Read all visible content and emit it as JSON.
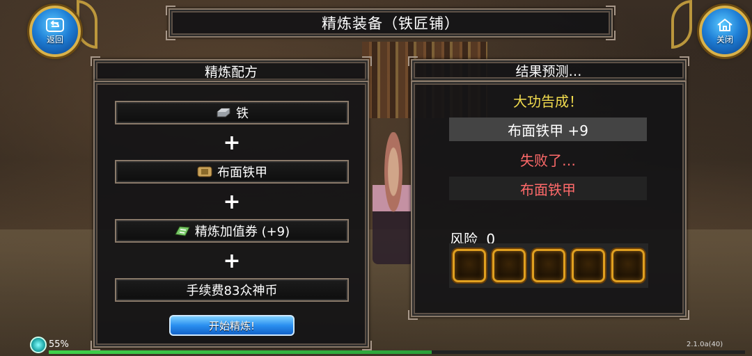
{
  "title": "精炼装备（铁匠铺）",
  "nav": {
    "back_label": "返回",
    "close_label": "关闭"
  },
  "recipe": {
    "header": "精炼配方",
    "items": [
      {
        "label": "铁",
        "icon": "iron-ingot-icon"
      },
      {
        "label": "布面铁甲",
        "icon": "armor-icon"
      },
      {
        "label": "精炼加值券 (+9)",
        "icon": "coupon-icon"
      },
      {
        "label": "手续费83众神币",
        "icon": ""
      }
    ],
    "plus": "+",
    "start_label": "开始精炼!"
  },
  "result": {
    "header": "结果预测…",
    "success_text": "大功告成！",
    "success_item": "布面铁甲 +9",
    "fail_text": "失败了…",
    "fail_item": "布面铁甲",
    "risk_label": "风险",
    "risk_value": "0",
    "risk_slots": 5
  },
  "status": {
    "percent": "55%",
    "version": "2.1.0a(40)",
    "exp_fraction": 0.55
  },
  "colors": {
    "success": "#f2dc4e",
    "fail": "#ff6a6a",
    "accent_gold": "#d9b24a",
    "button_blue": "#2a8ff0"
  }
}
